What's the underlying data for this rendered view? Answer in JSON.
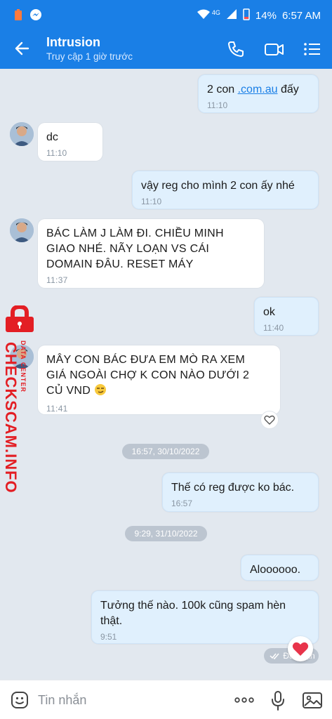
{
  "status_bar": {
    "battery": "14%",
    "time": "6:57 AM",
    "network": "4G"
  },
  "header": {
    "title": "Intrusion",
    "subtitle": "Truy cập 1 giờ trước"
  },
  "messages": [
    {
      "type": "out",
      "text_pre": "2 con ",
      "link": ".com.au",
      "text_post": " đấy",
      "time": "11:10"
    },
    {
      "type": "in",
      "text": "dc",
      "time": "11:10"
    },
    {
      "type": "out",
      "text": "vậy reg cho mình 2 con ấy nhé",
      "time": "11:10"
    },
    {
      "type": "in",
      "line1": "BÁC LÀM J LÀM ĐI. CHIỀU MINH",
      "line2": "GIAO NHÉ. NÃY LOẠN VS CÁI",
      "line3": "DOMAIN ĐÂU. RESET MÁY",
      "time": "11:37"
    },
    {
      "type": "out",
      "text": "ok",
      "time": "11:40"
    },
    {
      "type": "in",
      "line1": "MÂY CON BÁC ĐƯA EM MÒ RA XEM",
      "line2": "GIÁ NGOÀI CHỢ K CON NÀO DƯỚI 2",
      "line3": "CỦ VND",
      "time": "11:41"
    },
    {
      "type": "out",
      "text": "Thế có reg được ko bác.",
      "time": "16:57"
    },
    {
      "type": "out",
      "text": "Aloooooo."
    },
    {
      "type": "out",
      "line1": "Tưởng thế nào. 100k cũng spam hèn",
      "line2": "thật.",
      "time": "9:51",
      "status": "Đã nhận"
    }
  ],
  "date_chips": [
    "16:57, 30/10/2022",
    "9:29, 31/10/2022"
  ],
  "watermark": {
    "main": "CHECKSCAM.INFO",
    "small": "DATA CENTER"
  },
  "input": {
    "placeholder": "Tin nhắn"
  },
  "colors": {
    "accent": "#1a7fe6",
    "out_bubble": "#e0f0fd",
    "in_bubble": "#ffffff",
    "watermark": "#e31e24"
  },
  "icons": [
    "back-arrow-icon",
    "phone-icon",
    "video-call-icon",
    "menu-list-icon",
    "emoji-icon",
    "more-dots-icon",
    "microphone-icon",
    "image-icon",
    "heart-icon",
    "heart-outline-icon",
    "double-check-icon",
    "lock-icon"
  ]
}
